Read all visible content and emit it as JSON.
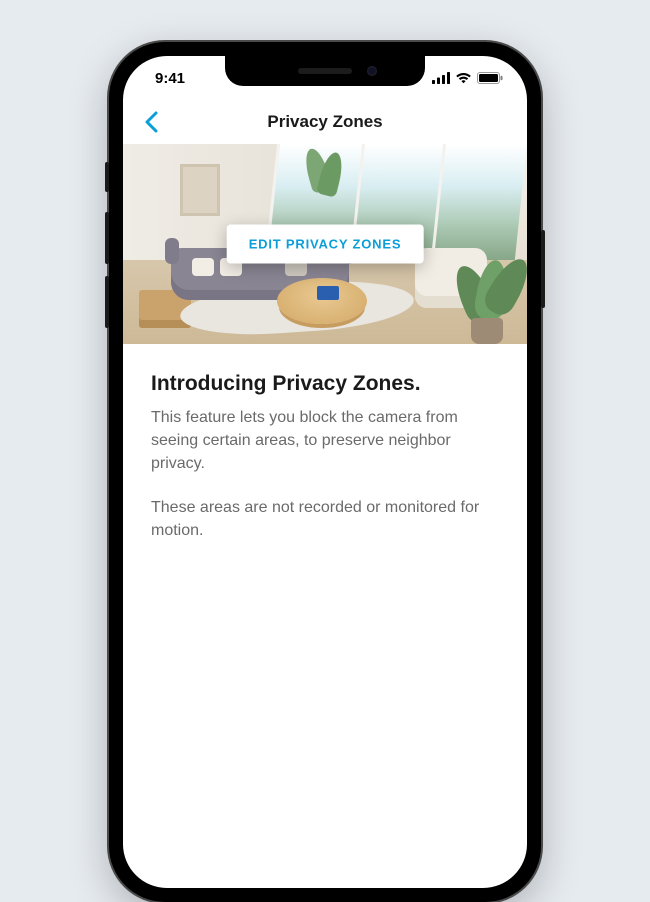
{
  "status": {
    "time": "9:41"
  },
  "nav": {
    "title": "Privacy Zones"
  },
  "hero": {
    "edit_button": "EDIT PRIVACY ZONES"
  },
  "content": {
    "heading": "Introducing Privacy Zones.",
    "paragraph1": "This feature lets you block the camera from seeing certain areas, to preserve neighbor privacy.",
    "paragraph2": "These areas are not recorded or monitored for motion."
  },
  "colors": {
    "accent": "#0b9ed9",
    "background": "#e6ebf0"
  }
}
